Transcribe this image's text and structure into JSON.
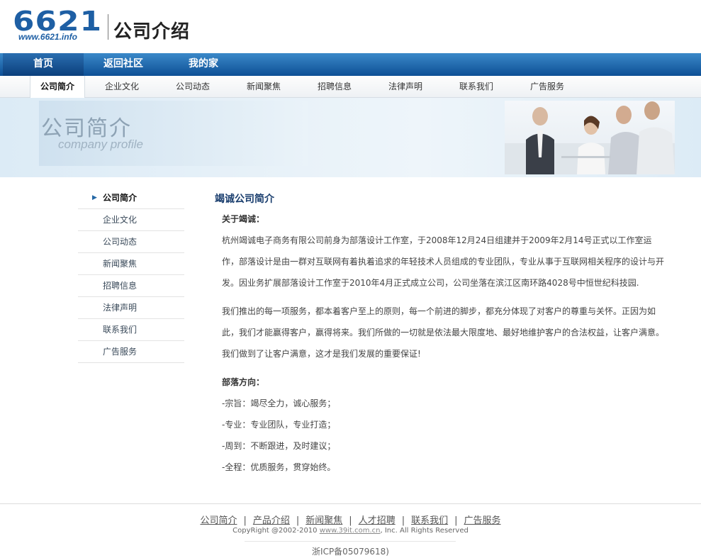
{
  "header": {
    "logo_number": "6621",
    "logo_url": "www.6621.info",
    "site_name": "公司介绍"
  },
  "main_nav": [
    {
      "label": "首页",
      "active": true
    },
    {
      "label": "返回社区",
      "active": false
    },
    {
      "label": "我的家",
      "active": false
    }
  ],
  "sub_nav": [
    {
      "label": "公司简介",
      "active": true
    },
    {
      "label": "企业文化",
      "active": false
    },
    {
      "label": "公司动态",
      "active": false
    },
    {
      "label": "新闻聚焦",
      "active": false
    },
    {
      "label": "招聘信息",
      "active": false
    },
    {
      "label": "法律声明",
      "active": false
    },
    {
      "label": "联系我们",
      "active": false
    },
    {
      "label": "广告服务",
      "active": false
    }
  ],
  "banner": {
    "title_cn": "公司简介",
    "title_en": "company profile"
  },
  "sidebar": [
    {
      "label": "公司简介",
      "active": true
    },
    {
      "label": "企业文化",
      "active": false
    },
    {
      "label": "公司动态",
      "active": false
    },
    {
      "label": "新闻聚焦",
      "active": false
    },
    {
      "label": "招聘信息",
      "active": false
    },
    {
      "label": "法律声明",
      "active": false
    },
    {
      "label": "联系我们",
      "active": false
    },
    {
      "label": "广告服务",
      "active": false
    }
  ],
  "content": {
    "title": "竭诚公司简介",
    "about_heading": "关于竭诚：",
    "about_para": "杭州竭诚电子商务有限公司前身为部落设计工作室，于2008年12月24日组建并于2009年2月14号正式以工作室运作，部落设计是由一群对互联网有着执着追求的年轻技术人员组成的专业团队，专业从事于互联网相关程序的设计与开发。因业务扩展部落设计工作室于2010年4月正式成立公司，公司坐落在滨江区南环路4028号中恒世纪科技园.",
    "service_para": "我们推出的每一项服务，都本着客户至上的原则，每一个前进的脚步，都充分体现了对客户的尊重与关怀。正因为如此，我们才能赢得客户，赢得将来。我们所做的一切就是依法最大限度地、最好地维护客户的合法权益，让客户满意。我们做到了让客户满意，这才是我们发展的重要保证!",
    "direction_heading": "部落方向：",
    "directions": [
      "-宗旨：竭尽全力，诚心服务；",
      "-专业：专业团队，专业打造；",
      "-周到：不断跟进，及时建议；",
      "-全程：优质服务，贯穿始终。"
    ]
  },
  "footer": {
    "links": [
      "公司简介",
      "产品介绍",
      "新闻聚焦",
      "人才招聘",
      "联系我们",
      "广告服务"
    ],
    "separator": "|",
    "copyright_prefix": "CopyRight @2002-2010 ",
    "copyright_site": "www.39it.com.cn",
    "copyright_suffix": ", Inc. All Rights Reserved",
    "icp": "浙ICP备05079618)"
  },
  "colors": {
    "nav_blue": "#0d4f95",
    "title_blue": "#1a3e6e",
    "logo_blue": "#1e5fa4"
  }
}
